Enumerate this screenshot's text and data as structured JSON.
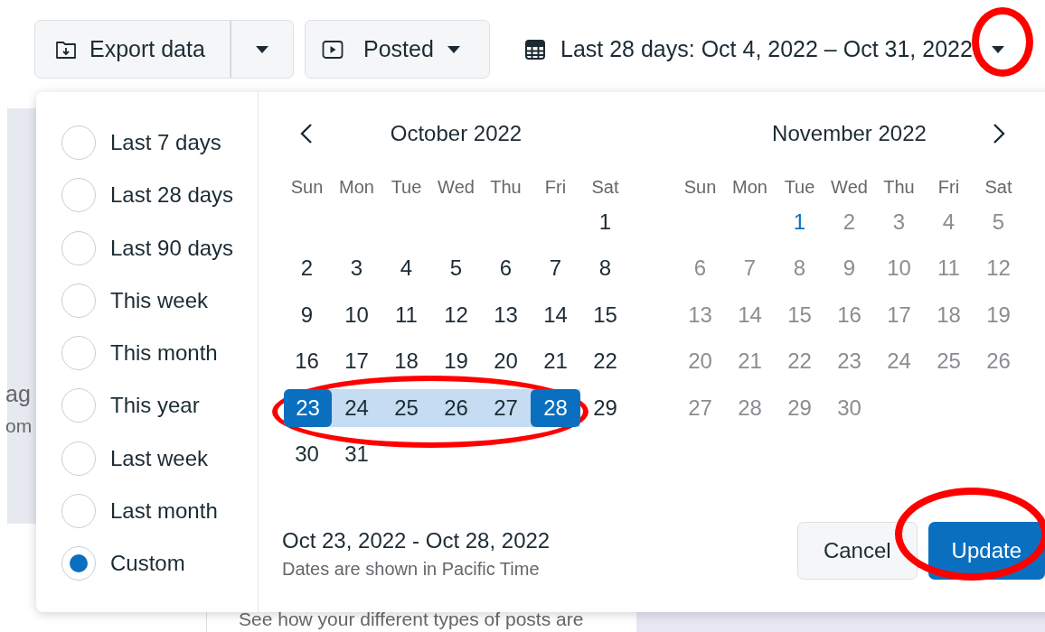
{
  "toolbar": {
    "export": {
      "label": "Export data"
    },
    "filter": {
      "label": "Posted"
    },
    "date_range": {
      "label": "Last 28 days: Oct 4, 2022 – Oct 31, 2022"
    }
  },
  "background": {
    "side_texts": [
      "ag",
      "om"
    ],
    "bottom_text": "See how your different types of posts are"
  },
  "presets": [
    {
      "label": "Last 7 days",
      "selected": false
    },
    {
      "label": "Last 28 days",
      "selected": false
    },
    {
      "label": "Last 90 days",
      "selected": false
    },
    {
      "label": "This week",
      "selected": false
    },
    {
      "label": "This month",
      "selected": false
    },
    {
      "label": "This year",
      "selected": false
    },
    {
      "label": "Last week",
      "selected": false
    },
    {
      "label": "Last month",
      "selected": false
    },
    {
      "label": "Custom",
      "selected": true
    }
  ],
  "calendar": {
    "months": [
      {
        "title": "October 2022",
        "weekdays": [
          "Sun",
          "Mon",
          "Tue",
          "Wed",
          "Thu",
          "Fri",
          "Sat"
        ],
        "weeks": [
          {
            "kind": "lead",
            "days": [
              {
                "label": "1",
                "selected": false,
                "in_range": false,
                "disabled": false,
                "today": false
              }
            ]
          },
          {
            "kind": "full",
            "days": [
              {
                "label": "2",
                "selected": false,
                "in_range": false,
                "disabled": false,
                "today": false
              },
              {
                "label": "3",
                "selected": false,
                "in_range": false,
                "disabled": false,
                "today": false
              },
              {
                "label": "4",
                "selected": false,
                "in_range": false,
                "disabled": false,
                "today": false
              },
              {
                "label": "5",
                "selected": false,
                "in_range": false,
                "disabled": false,
                "today": false
              },
              {
                "label": "6",
                "selected": false,
                "in_range": false,
                "disabled": false,
                "today": false
              },
              {
                "label": "7",
                "selected": false,
                "in_range": false,
                "disabled": false,
                "today": false
              },
              {
                "label": "8",
                "selected": false,
                "in_range": false,
                "disabled": false,
                "today": false
              }
            ]
          },
          {
            "kind": "full",
            "days": [
              {
                "label": "9",
                "selected": false,
                "in_range": false,
                "disabled": false,
                "today": false
              },
              {
                "label": "10",
                "selected": false,
                "in_range": false,
                "disabled": false,
                "today": false
              },
              {
                "label": "11",
                "selected": false,
                "in_range": false,
                "disabled": false,
                "today": false
              },
              {
                "label": "12",
                "selected": false,
                "in_range": false,
                "disabled": false,
                "today": false
              },
              {
                "label": "13",
                "selected": false,
                "in_range": false,
                "disabled": false,
                "today": false
              },
              {
                "label": "14",
                "selected": false,
                "in_range": false,
                "disabled": false,
                "today": false
              },
              {
                "label": "15",
                "selected": false,
                "in_range": false,
                "disabled": false,
                "today": false
              }
            ]
          },
          {
            "kind": "full",
            "days": [
              {
                "label": "16",
                "selected": false,
                "in_range": false,
                "disabled": false,
                "today": false
              },
              {
                "label": "17",
                "selected": false,
                "in_range": false,
                "disabled": false,
                "today": false
              },
              {
                "label": "18",
                "selected": false,
                "in_range": false,
                "disabled": false,
                "today": false
              },
              {
                "label": "19",
                "selected": false,
                "in_range": false,
                "disabled": false,
                "today": false
              },
              {
                "label": "20",
                "selected": false,
                "in_range": false,
                "disabled": false,
                "today": false
              },
              {
                "label": "21",
                "selected": false,
                "in_range": false,
                "disabled": false,
                "today": false
              },
              {
                "label": "22",
                "selected": false,
                "in_range": false,
                "disabled": false,
                "today": false
              }
            ]
          },
          {
            "kind": "full",
            "days": [
              {
                "label": "23",
                "selected": true,
                "in_range": true,
                "disabled": false,
                "today": false
              },
              {
                "label": "24",
                "selected": false,
                "in_range": true,
                "disabled": false,
                "today": false
              },
              {
                "label": "25",
                "selected": false,
                "in_range": true,
                "disabled": false,
                "today": false
              },
              {
                "label": "26",
                "selected": false,
                "in_range": true,
                "disabled": false,
                "today": false
              },
              {
                "label": "27",
                "selected": false,
                "in_range": true,
                "disabled": false,
                "today": false
              },
              {
                "label": "28",
                "selected": true,
                "in_range": true,
                "disabled": false,
                "today": false
              },
              {
                "label": "29",
                "selected": false,
                "in_range": false,
                "disabled": false,
                "today": false
              }
            ]
          },
          {
            "kind": "trail",
            "days": [
              {
                "label": "30",
                "selected": false,
                "in_range": false,
                "disabled": false,
                "today": false
              },
              {
                "label": "31",
                "selected": false,
                "in_range": false,
                "disabled": false,
                "today": false
              }
            ]
          }
        ]
      },
      {
        "title": "November 2022",
        "weekdays": [
          "Sun",
          "Mon",
          "Tue",
          "Wed",
          "Thu",
          "Fri",
          "Sat"
        ],
        "weeks": [
          {
            "kind": "lead",
            "days": [
              {
                "label": "1",
                "selected": false,
                "in_range": false,
                "disabled": true,
                "today": true
              },
              {
                "label": "2",
                "selected": false,
                "in_range": false,
                "disabled": true,
                "today": false
              },
              {
                "label": "3",
                "selected": false,
                "in_range": false,
                "disabled": true,
                "today": false
              },
              {
                "label": "4",
                "selected": false,
                "in_range": false,
                "disabled": true,
                "today": false
              },
              {
                "label": "5",
                "selected": false,
                "in_range": false,
                "disabled": true,
                "today": false
              }
            ]
          },
          {
            "kind": "full",
            "days": [
              {
                "label": "6",
                "selected": false,
                "in_range": false,
                "disabled": true,
                "today": false
              },
              {
                "label": "7",
                "selected": false,
                "in_range": false,
                "disabled": true,
                "today": false
              },
              {
                "label": "8",
                "selected": false,
                "in_range": false,
                "disabled": true,
                "today": false
              },
              {
                "label": "9",
                "selected": false,
                "in_range": false,
                "disabled": true,
                "today": false
              },
              {
                "label": "10",
                "selected": false,
                "in_range": false,
                "disabled": true,
                "today": false
              },
              {
                "label": "11",
                "selected": false,
                "in_range": false,
                "disabled": true,
                "today": false
              },
              {
                "label": "12",
                "selected": false,
                "in_range": false,
                "disabled": true,
                "today": false
              }
            ]
          },
          {
            "kind": "full",
            "days": [
              {
                "label": "13",
                "selected": false,
                "in_range": false,
                "disabled": true,
                "today": false
              },
              {
                "label": "14",
                "selected": false,
                "in_range": false,
                "disabled": true,
                "today": false
              },
              {
                "label": "15",
                "selected": false,
                "in_range": false,
                "disabled": true,
                "today": false
              },
              {
                "label": "16",
                "selected": false,
                "in_range": false,
                "disabled": true,
                "today": false
              },
              {
                "label": "17",
                "selected": false,
                "in_range": false,
                "disabled": true,
                "today": false
              },
              {
                "label": "18",
                "selected": false,
                "in_range": false,
                "disabled": true,
                "today": false
              },
              {
                "label": "19",
                "selected": false,
                "in_range": false,
                "disabled": true,
                "today": false
              }
            ]
          },
          {
            "kind": "full",
            "days": [
              {
                "label": "20",
                "selected": false,
                "in_range": false,
                "disabled": true,
                "today": false
              },
              {
                "label": "21",
                "selected": false,
                "in_range": false,
                "disabled": true,
                "today": false
              },
              {
                "label": "22",
                "selected": false,
                "in_range": false,
                "disabled": true,
                "today": false
              },
              {
                "label": "23",
                "selected": false,
                "in_range": false,
                "disabled": true,
                "today": false
              },
              {
                "label": "24",
                "selected": false,
                "in_range": false,
                "disabled": true,
                "today": false
              },
              {
                "label": "25",
                "selected": false,
                "in_range": false,
                "disabled": true,
                "today": false
              },
              {
                "label": "26",
                "selected": false,
                "in_range": false,
                "disabled": true,
                "today": false
              }
            ]
          },
          {
            "kind": "trail",
            "days": [
              {
                "label": "27",
                "selected": false,
                "in_range": false,
                "disabled": true,
                "today": false
              },
              {
                "label": "28",
                "selected": false,
                "in_range": false,
                "disabled": true,
                "today": false
              },
              {
                "label": "29",
                "selected": false,
                "in_range": false,
                "disabled": true,
                "today": false
              },
              {
                "label": "30",
                "selected": false,
                "in_range": false,
                "disabled": true,
                "today": false
              }
            ]
          }
        ]
      }
    ]
  },
  "footer": {
    "range": "Oct 23, 2022 - Oct 28, 2022",
    "timezone_note": "Dates are shown in Pacific Time",
    "buttons": [
      {
        "label": "Cancel",
        "kind": "secondary"
      },
      {
        "label": "Update",
        "kind": "primary"
      }
    ]
  }
}
